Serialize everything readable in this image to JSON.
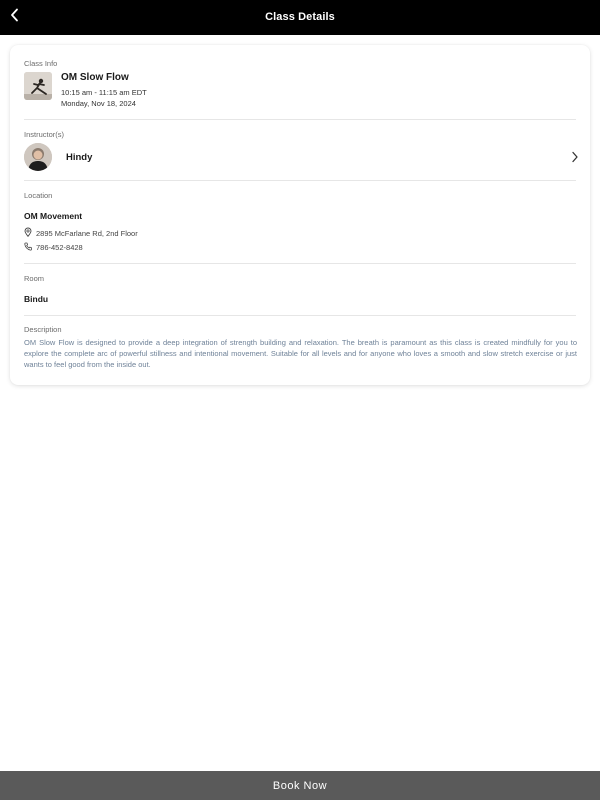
{
  "header": {
    "title": "Class Details",
    "back_icon": "chevron-left-icon"
  },
  "class_info": {
    "label": "Class Info",
    "name": "OM Slow Flow",
    "time": "10:15 am - 11:15 am EDT",
    "date": "Monday, Nov 18, 2024"
  },
  "instructors": {
    "label": "Instructor(s)",
    "name": "Hindy",
    "chevron_icon": "chevron-right-icon"
  },
  "location": {
    "label": "Location",
    "name": "OM Movement",
    "address": "2895 McFarlane Rd, 2nd Floor",
    "phone": "786-452-8428",
    "address_icon": "map-pin-icon",
    "phone_icon": "phone-icon"
  },
  "room": {
    "label": "Room",
    "name": "Bindu"
  },
  "description": {
    "label": "Description",
    "text": "OM Slow Flow is designed to provide a deep integration of strength building and relaxation. The breath is paramount as this class is created mindfully for you to explore the complete arc of powerful stillness and intentional movement. Suitable for all levels and for anyone who loves a smooth and slow stretch exercise or just wants to feel good from the inside out."
  },
  "footer": {
    "book_label": "Book Now"
  },
  "colors": {
    "header_bg": "#000000",
    "book_button_bg": "#5a5a5a",
    "description_text": "#6f8298"
  }
}
